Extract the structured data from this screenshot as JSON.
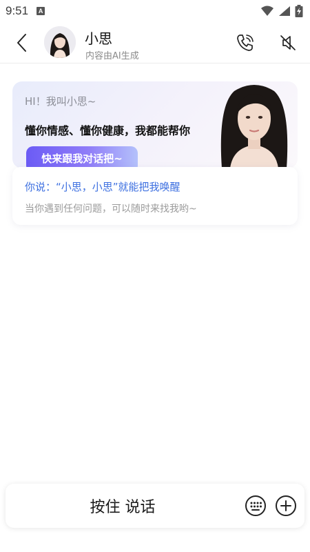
{
  "status_bar": {
    "time": "9:51",
    "badge": "A",
    "icons": [
      "wifi-icon",
      "signal-icon",
      "battery-charging-icon"
    ]
  },
  "header": {
    "name": "小思",
    "subtitle": "内容由AI生成",
    "icons": [
      "back-icon",
      "phone-call-icon",
      "speaker-mute-icon"
    ]
  },
  "intro": {
    "greeting": "HI！我叫小思~",
    "tagline": "懂你情感、懂你健康，我都能帮你",
    "cta": "快来跟我对话把~"
  },
  "wake": {
    "title": "你说：“小思，小思”就能把我唤醒",
    "subtitle": "当你遇到任何问题，可以随时来找我哟~"
  },
  "input_bar": {
    "hold_to_talk": "按住 说话",
    "icons": [
      "keyboard-icon",
      "plus-icon"
    ]
  },
  "colors": {
    "accent_blue": "#3c6fe0",
    "cta_gradient_start": "#6b5bf5",
    "cta_gradient_end": "#b4c1fb"
  }
}
